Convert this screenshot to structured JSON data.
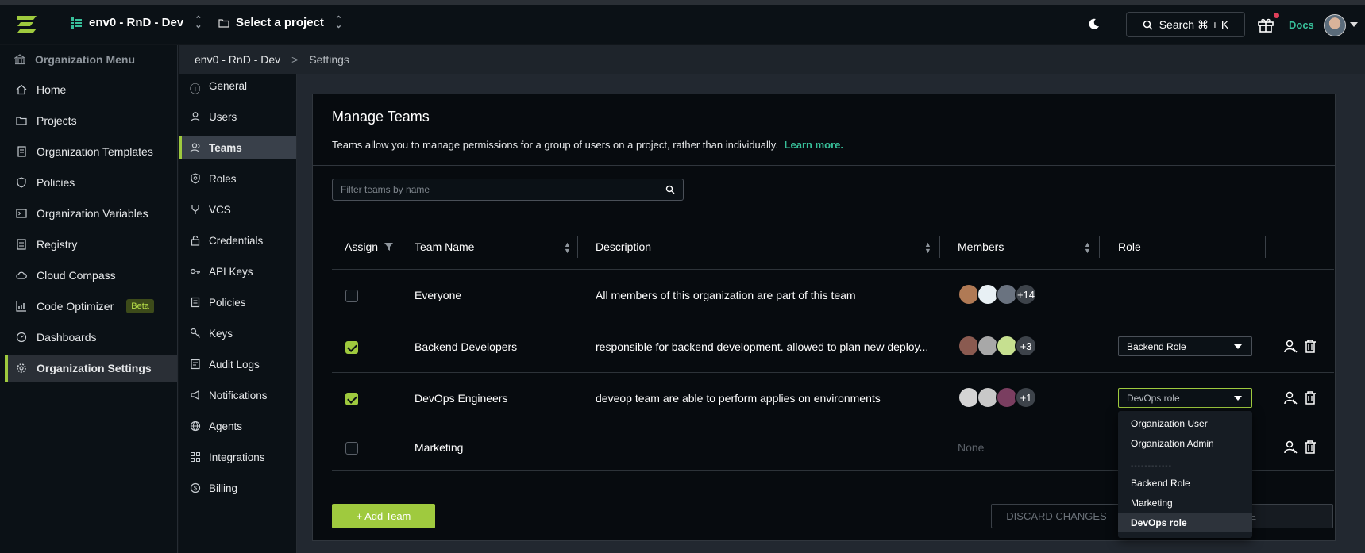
{
  "topbar": {
    "environment": "env0 - RnD - Dev",
    "project": "Select a project",
    "search_label": "Search ⌘ + K",
    "docs": "Docs"
  },
  "sidebar": {
    "title": "Organization Menu",
    "items": [
      {
        "label": "Home",
        "icon": "home-icon"
      },
      {
        "label": "Projects",
        "icon": "folder-icon"
      },
      {
        "label": "Organization Templates",
        "icon": "template-icon"
      },
      {
        "label": "Policies",
        "icon": "shield-icon"
      },
      {
        "label": "Organization Variables",
        "icon": "terminal-icon"
      },
      {
        "label": "Registry",
        "icon": "registry-icon"
      },
      {
        "label": "Cloud Compass",
        "icon": "cloud-icon"
      },
      {
        "label": "Code Optimizer",
        "icon": "chart-icon",
        "badge": "Beta"
      },
      {
        "label": "Dashboards",
        "icon": "gauge-icon"
      },
      {
        "label": "Organization Settings",
        "icon": "gear-icon",
        "active": true
      }
    ]
  },
  "breadcrumb": {
    "root": "env0 - RnD - Dev",
    "current": "Settings"
  },
  "settings_menu": {
    "items": [
      {
        "label": "General",
        "icon": "info-icon"
      },
      {
        "label": "Users",
        "icon": "user-icon"
      },
      {
        "label": "Teams",
        "icon": "team-icon",
        "active": true
      },
      {
        "label": "Roles",
        "icon": "badge-icon"
      },
      {
        "label": "VCS",
        "icon": "branch-icon"
      },
      {
        "label": "Credentials",
        "icon": "lock-icon"
      },
      {
        "label": "API Keys",
        "icon": "api-key-icon"
      },
      {
        "label": "Policies",
        "icon": "policy-icon"
      },
      {
        "label": "Keys",
        "icon": "key-icon"
      },
      {
        "label": "Audit Logs",
        "icon": "audit-icon"
      },
      {
        "label": "Notifications",
        "icon": "megaphone-icon"
      },
      {
        "label": "Agents",
        "icon": "globe-icon"
      },
      {
        "label": "Integrations",
        "icon": "grid-icon"
      },
      {
        "label": "Billing",
        "icon": "dollar-icon"
      }
    ]
  },
  "manage_teams": {
    "title": "Manage Teams",
    "description": "Teams allow you to manage permissions for a group of users on a project, rather than individually.",
    "learn_more": "Learn more.",
    "filter_placeholder": "Filter teams by name",
    "columns": {
      "assign": "Assign",
      "team_name": "Team Name",
      "description": "Description",
      "members": "Members",
      "role": "Role"
    },
    "rows": [
      {
        "assigned": false,
        "name": "Everyone",
        "description": "All members of this organization are part of this team",
        "members_more": "+14",
        "role": ""
      },
      {
        "assigned": true,
        "name": "Backend Developers",
        "description": "responsible for backend development. allowed to plan new deploy...",
        "members_more": "+3",
        "role": "Backend Role"
      },
      {
        "assigned": true,
        "name": "DevOps Engineers",
        "description": "deveop team are able to perform applies on environments",
        "members_more": "+1",
        "role": "DevOps role"
      },
      {
        "assigned": false,
        "name": "Marketing",
        "description": "",
        "members_none": "None",
        "role": ""
      }
    ],
    "add_team": "+ Add Team",
    "discard": "DISCARD CHANGES",
    "save": "VE"
  },
  "role_dropdown": {
    "options": [
      "Organization User",
      "Organization Admin",
      "------------",
      "Backend Role",
      "Marketing",
      "DevOps role"
    ],
    "selected": "DevOps role"
  },
  "colors": {
    "accent": "#9fca3e",
    "link": "#38c09a",
    "background": "#070b0f"
  }
}
